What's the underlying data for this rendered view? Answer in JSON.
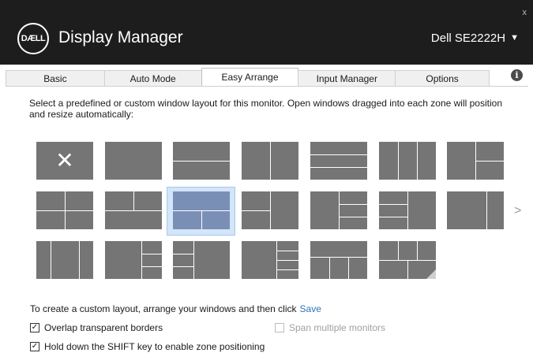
{
  "window": {
    "logo_text": "DÆLL",
    "title": "Display Manager",
    "monitor": "Dell SE2222H",
    "close_glyph": "x"
  },
  "tabs": [
    {
      "label": "Basic"
    },
    {
      "label": "Auto Mode"
    },
    {
      "label": "Easy Arrange",
      "active": true
    },
    {
      "label": "Input Manager"
    },
    {
      "label": "Options"
    }
  ],
  "info_glyph": "i",
  "description": "Select a predefined or custom window layout for this monitor.  Open windows dragged into each zone will position and resize automatically:",
  "layouts": {
    "items": 20,
    "selected": "3-column row 2, option 3",
    "next_arrow": ">"
  },
  "hint": {
    "text": "To create a custom layout, arrange your windows and then click",
    "link": "Save"
  },
  "options": {
    "overlap": {
      "label": "Overlap transparent borders",
      "checked": true
    },
    "span": {
      "label": "Span multiple monitors",
      "checked": false,
      "disabled": true
    },
    "shift": {
      "label": "Hold down the SHIFT key to enable zone positioning",
      "checked": true
    }
  },
  "colors": {
    "title_bg": "#1d1d1d",
    "tile": "#757575",
    "selected_tile": "#7a8fb6",
    "link": "#2f74c0"
  }
}
